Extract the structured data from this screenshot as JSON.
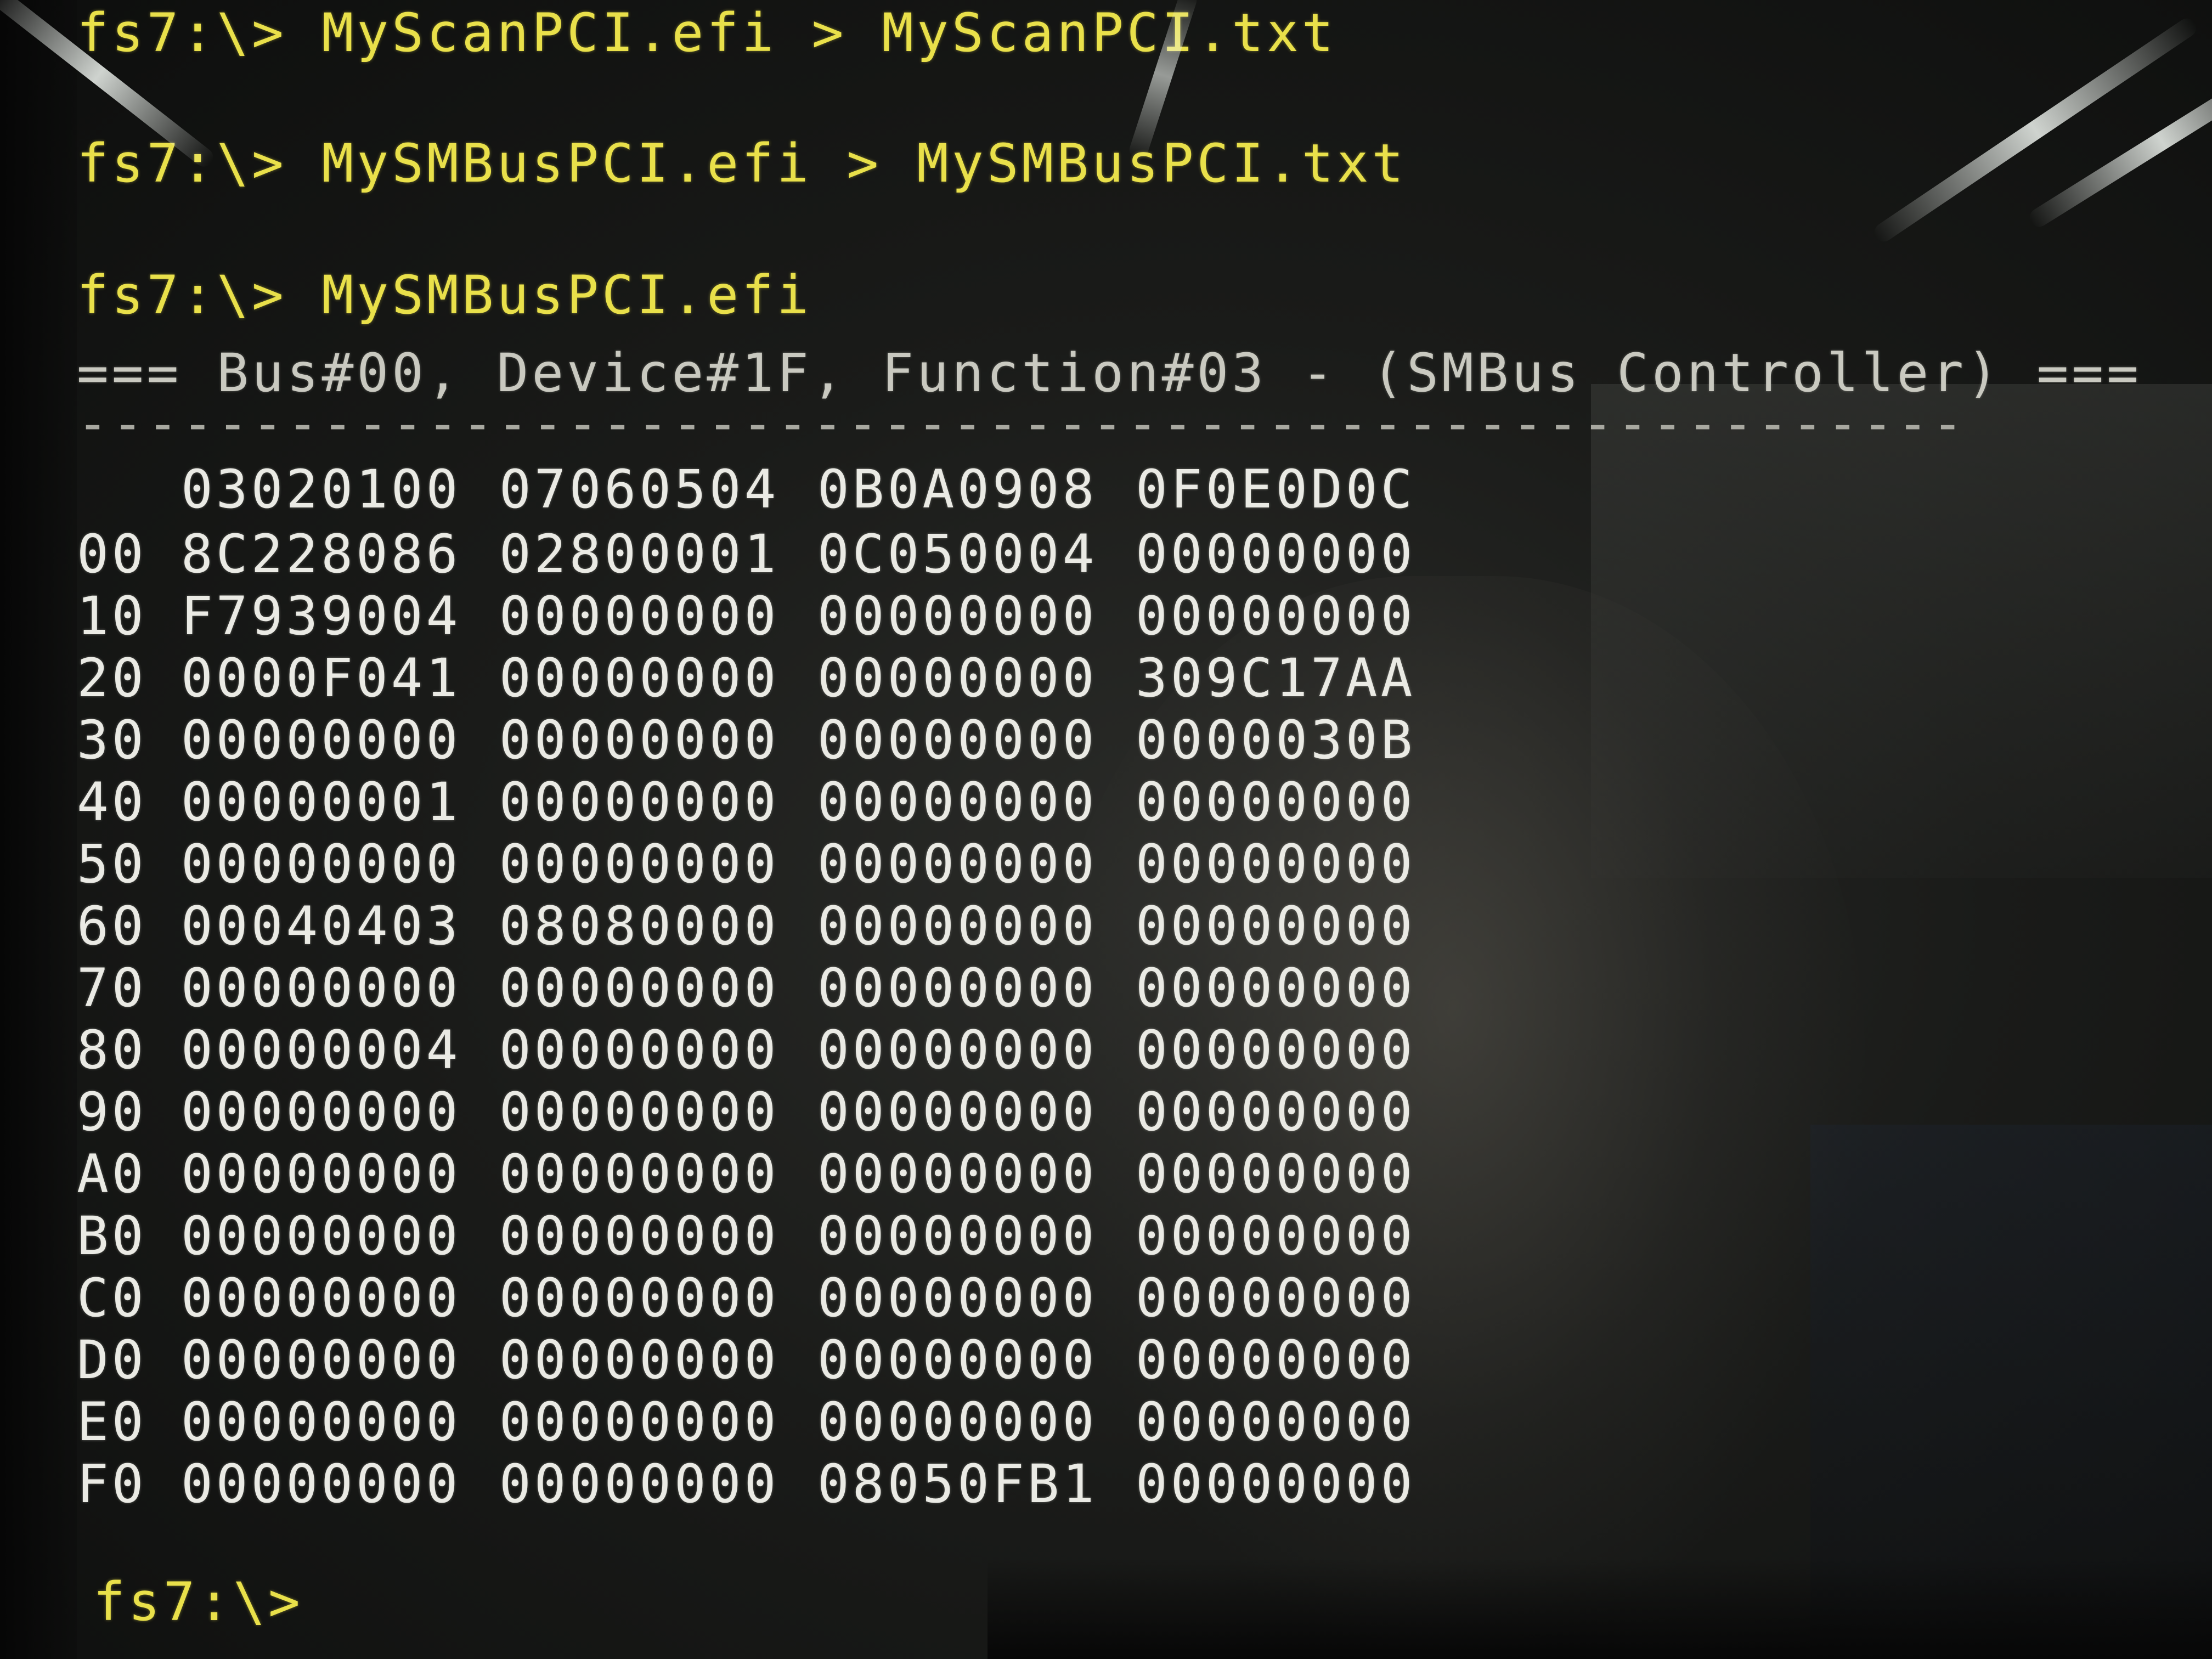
{
  "terminal": {
    "commands": [
      "fs7:\\> MyScanPCI.efi > MyScanPCI.txt",
      "fs7:\\> MySMBusPCI.efi > MySMBusPCI.txt",
      "fs7:\\> MySMBusPCI.efi"
    ],
    "title": "=== Bus#00, Device#1F, Function#03 - (SMBus Controller) ===",
    "separator": "------------------------------------------------------",
    "column_header": [
      "03020100",
      "07060504",
      "0B0A0908",
      "0F0E0D0C"
    ],
    "rows": [
      {
        "offset": "00",
        "cells": [
          "8C228086",
          "02800001",
          "0C050004",
          "00000000"
        ]
      },
      {
        "offset": "10",
        "cells": [
          "F7939004",
          "00000000",
          "00000000",
          "00000000"
        ]
      },
      {
        "offset": "20",
        "cells": [
          "0000F041",
          "00000000",
          "00000000",
          "309C17AA"
        ]
      },
      {
        "offset": "30",
        "cells": [
          "00000000",
          "00000000",
          "00000000",
          "0000030B"
        ]
      },
      {
        "offset": "40",
        "cells": [
          "00000001",
          "00000000",
          "00000000",
          "00000000"
        ]
      },
      {
        "offset": "50",
        "cells": [
          "00000000",
          "00000000",
          "00000000",
          "00000000"
        ]
      },
      {
        "offset": "60",
        "cells": [
          "00040403",
          "08080000",
          "00000000",
          "00000000"
        ]
      },
      {
        "offset": "70",
        "cells": [
          "00000000",
          "00000000",
          "00000000",
          "00000000"
        ]
      },
      {
        "offset": "80",
        "cells": [
          "00000004",
          "00000000",
          "00000000",
          "00000000"
        ]
      },
      {
        "offset": "90",
        "cells": [
          "00000000",
          "00000000",
          "00000000",
          "00000000"
        ]
      },
      {
        "offset": "A0",
        "cells": [
          "00000000",
          "00000000",
          "00000000",
          "00000000"
        ]
      },
      {
        "offset": "B0",
        "cells": [
          "00000000",
          "00000000",
          "00000000",
          "00000000"
        ]
      },
      {
        "offset": "C0",
        "cells": [
          "00000000",
          "00000000",
          "00000000",
          "00000000"
        ]
      },
      {
        "offset": "D0",
        "cells": [
          "00000000",
          "00000000",
          "00000000",
          "00000000"
        ]
      },
      {
        "offset": "E0",
        "cells": [
          "00000000",
          "00000000",
          "00000000",
          "00000000"
        ]
      },
      {
        "offset": "F0",
        "cells": [
          "00000000",
          "00000000",
          "08050FB1",
          "00000000"
        ]
      }
    ],
    "final_prompt": "fs7:\\>"
  },
  "colors": {
    "prompt": "#e9e04a",
    "header": "#c9c9c0",
    "data": "#eaeae4",
    "background": "#1a1b19"
  }
}
